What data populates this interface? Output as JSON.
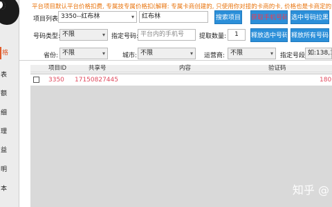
{
  "notice": "平台项目默认平台价格扣费, 专属技专属价格扣(解释: 专属卡商创建的, 只使用你对接的卡商的卡, 价格也是卡商定的, 这里只",
  "sidebar": {
    "items": [
      {
        "label": "格",
        "active": true
      },
      {
        "label": "表"
      },
      {
        "label": "额"
      },
      {
        "label": "细"
      },
      {
        "label": "理"
      },
      {
        "label": "益"
      },
      {
        "label": "明"
      },
      {
        "label": "本"
      }
    ]
  },
  "row1": {
    "project_list_label": "项目列表:",
    "project_select_value": "3350--红布林",
    "project_search_value": "红布林",
    "search_button": "搜索项目",
    "get_phone_button": "获取手机号码",
    "pull_black_button": "选中号码拉黑"
  },
  "row2": {
    "phone_type_label": "号码类型:",
    "phone_type_value": "不限",
    "designated_phone_label": "指定号码:",
    "designated_phone_placeholder": "平台内的手机号",
    "quantity_label": "提取数量:",
    "quantity_value": "1",
    "release_selected_button": "释放选中号码",
    "release_all_button": "释放所有号码"
  },
  "row3": {
    "province_label": "省份:",
    "province_value": "不限",
    "city_label": "城市:",
    "city_value": "不限",
    "operator_label": "运营商:",
    "operator_value": "不限",
    "segment_label": "指定号段:",
    "segment_value": "如:138,13"
  },
  "table": {
    "headers": [
      "项目ID",
      "共享号",
      "内容",
      "验证码"
    ],
    "rows": [
      {
        "project_id": "3350",
        "shared_no": "17150827445",
        "content": "",
        "code": "",
        "extra": "180"
      }
    ]
  },
  "watermark": "知乎 @",
  "colors": {
    "accent_blue": "#2b8fd9",
    "notice_orange": "#e8730c",
    "row_text_red": "#e0485c"
  }
}
